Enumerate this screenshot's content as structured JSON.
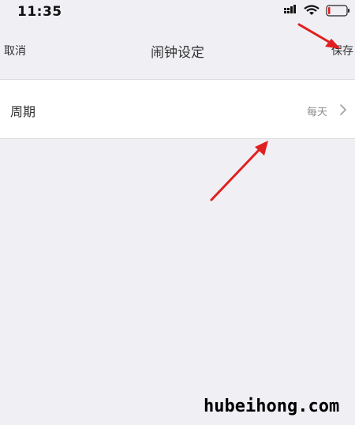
{
  "status_bar": {
    "time": "11:35",
    "icons": [
      "signal-icon",
      "wifi-icon",
      "battery-icon"
    ]
  },
  "nav": {
    "cancel_label": "取消",
    "title": "闹钟设定",
    "save_label": "保存"
  },
  "settings": {
    "rows": [
      {
        "label": "周期",
        "value": "每天",
        "icon": "chevron-right-icon"
      }
    ]
  },
  "watermark": "hubeihong.com",
  "annotation": {
    "arrow_color": "#e02020"
  }
}
